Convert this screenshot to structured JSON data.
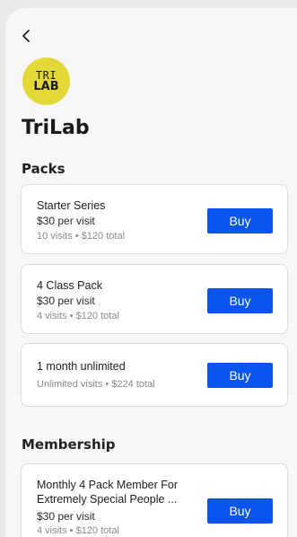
{
  "nav": {
    "back_icon": "chevron-left-icon"
  },
  "studio": {
    "logo_line1": "TRI",
    "logo_line2": "LAB",
    "logo_color": "#e4d838",
    "name": "TriLab"
  },
  "packs": {
    "title": "Packs",
    "items": [
      {
        "name": "Starter Series",
        "price": "$30 per visit",
        "meta": "10 visits • $120 total",
        "button": "Buy"
      },
      {
        "name": "4 Class Pack",
        "price": "$30 per visit",
        "meta": "4 visits • $120 total",
        "button": "Buy"
      },
      {
        "name": "1 month unlimited",
        "price": "",
        "meta": "Unlimited visits • $224 total",
        "button": "Buy"
      }
    ]
  },
  "membership": {
    "title": "Membership",
    "items": [
      {
        "name_line1": "Monthly 4 Pack Member For",
        "name_line2": "Extremely Special People ...",
        "price": "$30 per visit",
        "meta": "4 visits • $120 total",
        "button": "Buy"
      }
    ]
  },
  "accent_color": "#0a55f0"
}
